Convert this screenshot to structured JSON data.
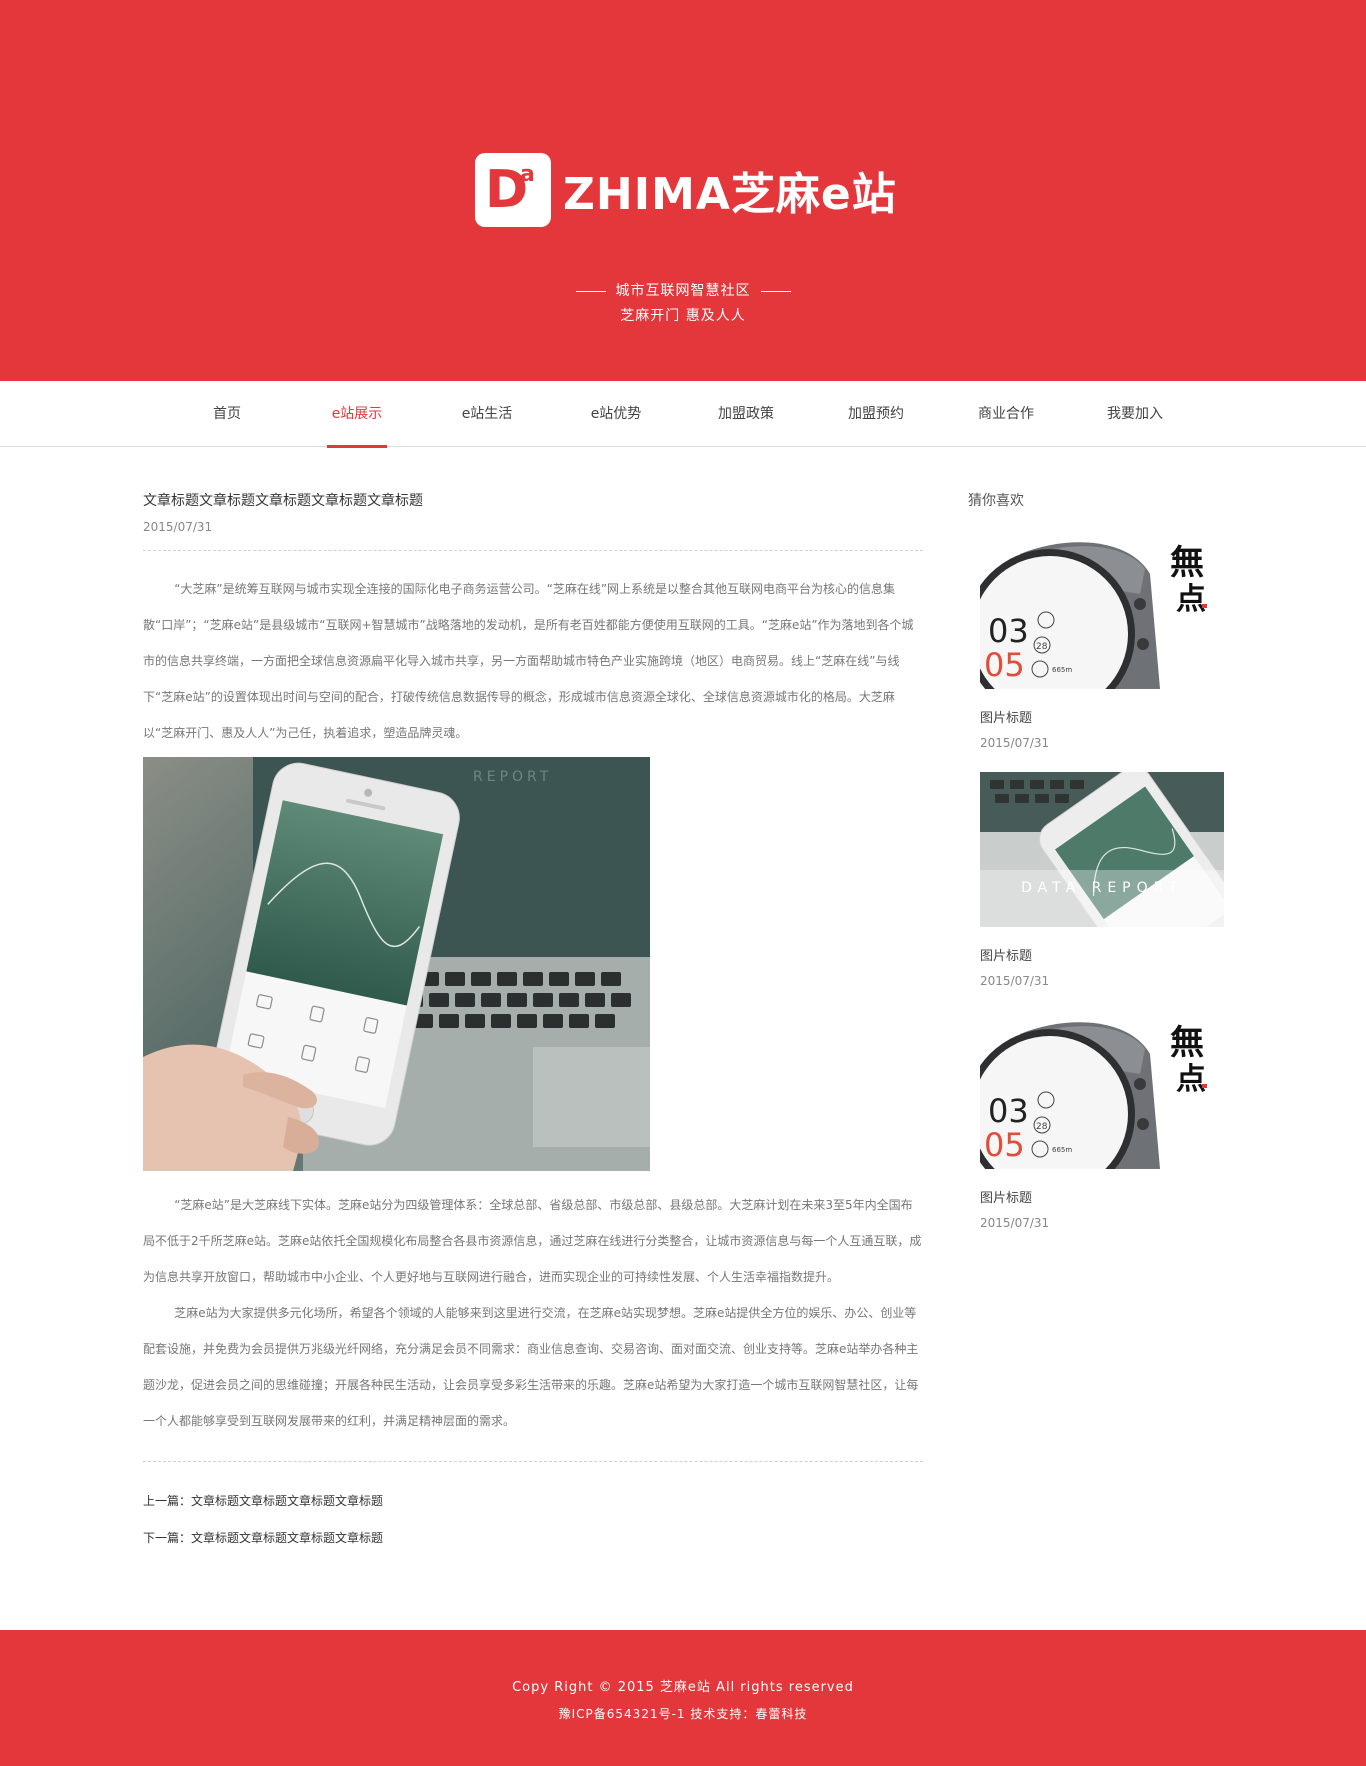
{
  "header": {
    "logo_mark": "D",
    "logo_mark_sup": "a",
    "logo_text": "ZHIMA芝麻e站",
    "tagline_main": "城市互联网智慧社区",
    "tagline_sub": "芝麻开门  惠及人人"
  },
  "nav": {
    "items": [
      {
        "label": "首页"
      },
      {
        "label": "e站展示"
      },
      {
        "label": "e站生活"
      },
      {
        "label": "e站优势"
      },
      {
        "label": "加盟政策"
      },
      {
        "label": "加盟预约"
      },
      {
        "label": "商业合作"
      },
      {
        "label": "我要加入"
      }
    ],
    "active_index": 1
  },
  "article": {
    "title": "文章标题文章标题文章标题文章标题文章标题",
    "date": "2015/07/31",
    "paragraph1": "“大芝麻”是统筹互联网与城市实现全连接的国际化电子商务运营公司。“芝麻在线”网上系统是以整合其他互联网电商平台为核心的信息集散“口岸”；“芝麻e站”是县级城市“互联网+智慧城市”战略落地的发动机，是所有老百姓都能方便使用互联网的工具。“芝麻e站”作为落地到各个城市的信息共享终端，一方面把全球信息资源扁平化导入城市共享，另一方面帮助城市特色产业实施跨境（地区）电商贸易。线上“芝麻在线”与线下“芝麻e站”的设置体现出时间与空间的配合，打破传统信息数据传导的概念，形成城市信息资源全球化、全球信息资源城市化的格局。大芝麻以“芝麻开门、惠及人人”为己任，执着追求，塑造品牌灵魂。",
    "paragraph2": "“芝麻e站”是大芝麻线下实体。芝麻e站分为四级管理体系：全球总部、省级总部、市级总部、县级总部。大芝麻计划在未来3至5年内全国布局不低于2千所芝麻e站。芝麻e站依托全国规模化布局整合各县市资源信息，通过芝麻在线进行分类整合，让城市资源信息与每一个人互通互联，成为信息共享开放窗口，帮助城市中小企业、个人更好地与互联网进行融合，进而实现企业的可持续性发展、个人生活幸福指数提升。",
    "paragraph3": "芝麻e站为大家提供多元化场所，希望各个领域的人能够来到这里进行交流，在芝麻e站实现梦想。芝麻e站提供全方位的娱乐、办公、创业等配套设施，并免费为会员提供万兆级光纤网络，充分满足会员不同需求：商业信息查询、交易咨询、面对面交流、创业支持等。芝麻e站举办各种主题沙龙，促进会员之间的思维碰撞；开展各种民生活动，让会员享受多彩生活带来的乐趣。芝麻e站希望为大家打造一个城市互联网智慧社区，让每一个人都能够享受到互联网发展带来的红利，并满足精神层面的需求。",
    "prev": "上一篇：文章标题文章标题文章标题文章标题",
    "next": "下一篇：文章标题文章标题文章标题文章标题",
    "image": {
      "screen_labels": [
        "REPORT"
      ]
    }
  },
  "sidebar": {
    "title": "猜你喜欢",
    "cards": [
      {
        "title": "图片标题",
        "date": "2015/07/31",
        "kind": "watch",
        "big1": "03",
        "big2": "05",
        "brush1": "無",
        "brush2": "点",
        "small": [
          "28",
          "665m"
        ]
      },
      {
        "title": "图片标题",
        "date": "2015/07/31",
        "kind": "report",
        "overlay": "DATA REPORT"
      },
      {
        "title": "图片标题",
        "date": "2015/07/31",
        "kind": "watch",
        "big1": "03",
        "big2": "05",
        "brush1": "無",
        "brush2": "点",
        "small": [
          "28",
          "665m"
        ]
      }
    ]
  },
  "footer": {
    "copyright": "Copy Right © 2015 芝麻e站 All rights reserved",
    "icp": "豫ICP备654321号-1 技术支持：春蕾科技"
  },
  "colors": {
    "brand_red": "#e3373b",
    "text_dark": "#333333",
    "text_gray": "#777777"
  }
}
